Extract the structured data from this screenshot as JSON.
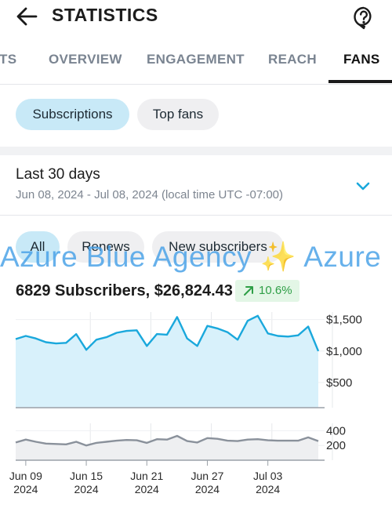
{
  "header": {
    "title": "STATISTICS"
  },
  "tabs": [
    {
      "label": "ITS"
    },
    {
      "label": "OVERVIEW"
    },
    {
      "label": "ENGAGEMENT"
    },
    {
      "label": "REACH"
    },
    {
      "label": "FANS",
      "active": true
    }
  ],
  "chips_top": {
    "subscriptions": "Subscriptions",
    "top_fans": "Top fans"
  },
  "range": {
    "title": "Last 30 days",
    "subtitle": "Jun 08, 2024 - Jul 08, 2024 (local time UTC -07:00)"
  },
  "filters": {
    "all": "All",
    "renews": "Renews",
    "new_subscribers": "New subscribers"
  },
  "watermark": "Azure Blue Agency ✨ Azure",
  "summary": {
    "text": "6829 Subscribers, $26,824.43",
    "growth": "10.6%"
  },
  "colors": {
    "accent": "#1aa8dc",
    "accent_fill": "#d8f1fb",
    "secondary_line": "#8a919b",
    "growth_green": "#2e9e46"
  },
  "chart_data": [
    {
      "type": "area",
      "x": [
        "Jun 08",
        "Jun 09",
        "Jun 10",
        "Jun 11",
        "Jun 12",
        "Jun 13",
        "Jun 14",
        "Jun 15",
        "Jun 16",
        "Jun 17",
        "Jun 18",
        "Jun 19",
        "Jun 20",
        "Jun 21",
        "Jun 22",
        "Jun 23",
        "Jun 24",
        "Jun 25",
        "Jun 26",
        "Jun 27",
        "Jun 28",
        "Jun 29",
        "Jun 30",
        "Jul 01",
        "Jul 02",
        "Jul 03",
        "Jul 04",
        "Jul 05",
        "Jul 06",
        "Jul 07",
        "Jul 08"
      ],
      "values": [
        1190,
        1240,
        1200,
        1140,
        1120,
        1130,
        1270,
        1020,
        1180,
        1220,
        1290,
        1320,
        1330,
        1080,
        1270,
        1260,
        1540,
        1200,
        1080,
        1400,
        1360,
        1300,
        1180,
        1480,
        1560,
        1280,
        1240,
        1230,
        1250,
        1390,
        1000
      ],
      "y_ticks": [
        "$1,500",
        "$1,000",
        "$500"
      ],
      "y_tick_values": [
        1500,
        1000,
        500
      ],
      "ylim": [
        100,
        1620
      ],
      "grid": true,
      "x_tick_labels": [
        {
          "date": "Jun 09",
          "year": "2024"
        },
        {
          "date": "Jun 15",
          "year": "2024"
        },
        {
          "date": "Jun 21",
          "year": "2024"
        },
        {
          "date": "Jun 27",
          "year": "2024"
        },
        {
          "date": "Jul 03",
          "year": "2024"
        }
      ]
    },
    {
      "type": "line",
      "values": [
        240,
        280,
        250,
        225,
        220,
        215,
        250,
        200,
        235,
        250,
        265,
        275,
        270,
        235,
        285,
        280,
        330,
        260,
        240,
        300,
        290,
        265,
        260,
        280,
        285,
        270,
        265,
        265,
        265,
        310,
        260
      ],
      "y_ticks": [
        "400",
        "200"
      ],
      "y_tick_values": [
        400,
        200
      ],
      "ylim": [
        0,
        500
      ],
      "grid": true
    }
  ]
}
